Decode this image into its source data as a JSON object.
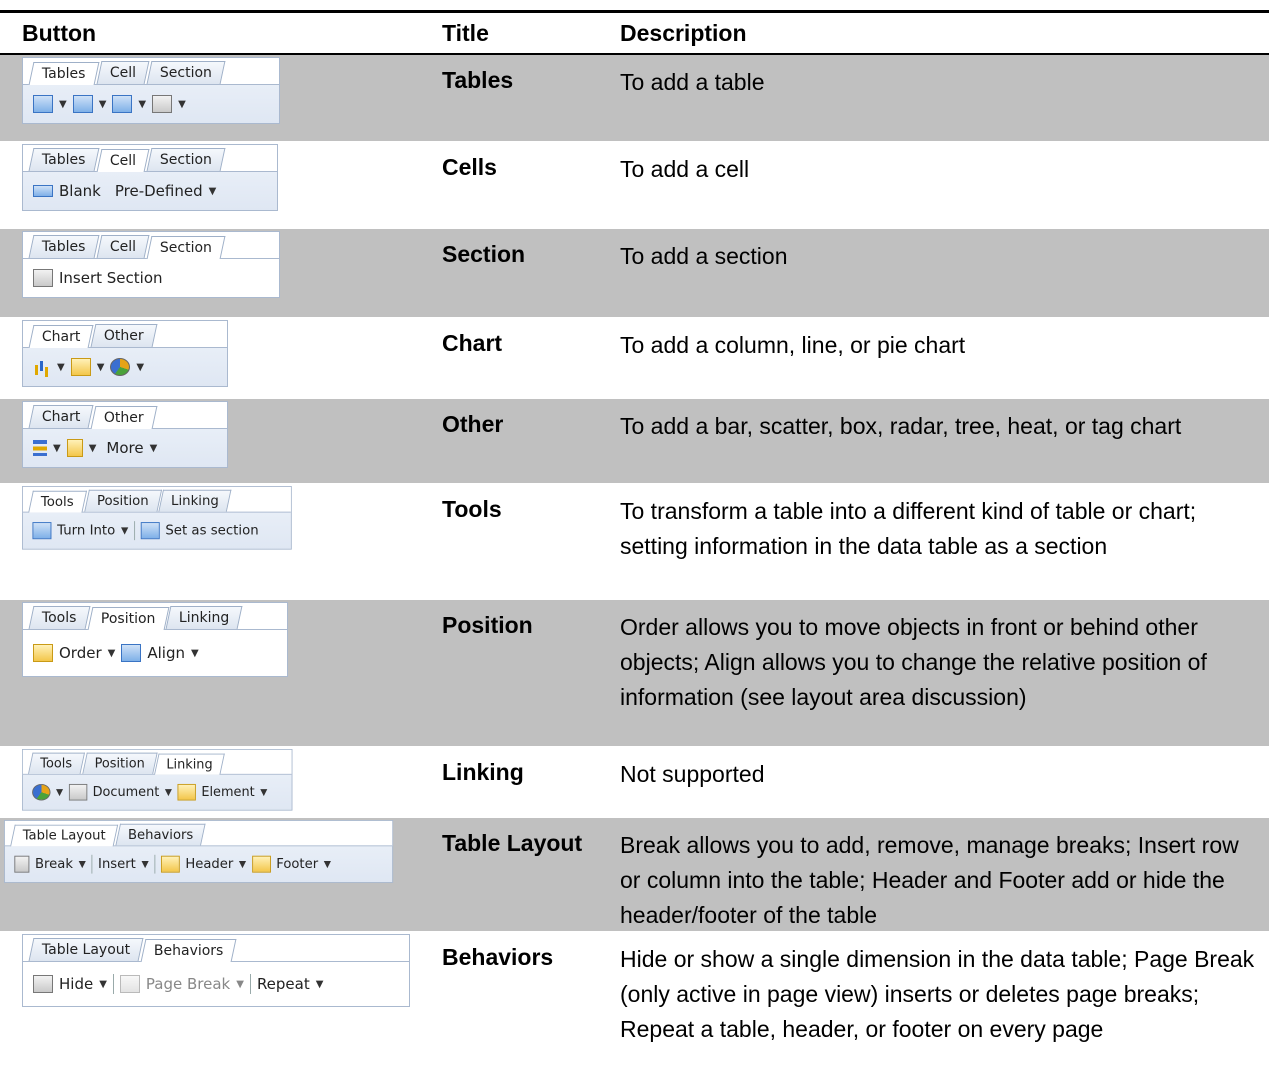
{
  "headers": {
    "button": "Button",
    "title": "Title",
    "description": "Description"
  },
  "rows": [
    {
      "title": "Tables",
      "description": "To add a table",
      "shaded": true,
      "ribbon": {
        "tabs": [
          "Tables",
          "Cell",
          "Section"
        ],
        "active": 0
      }
    },
    {
      "title": "Cells",
      "description": "To add a cell",
      "shaded": false,
      "ribbon": {
        "tabs": [
          "Tables",
          "Cell",
          "Section"
        ],
        "active": 1,
        "items": [
          "Blank",
          "Pre-Defined"
        ]
      }
    },
    {
      "title": "Section",
      "description": "To add a section",
      "shaded": true,
      "ribbon": {
        "tabs": [
          "Tables",
          "Cell",
          "Section"
        ],
        "active": 2,
        "items": [
          "Insert Section"
        ]
      }
    },
    {
      "title": "Chart",
      "description": "To add a column, line, or pie chart",
      "shaded": false,
      "ribbon": {
        "tabs": [
          "Chart",
          "Other"
        ],
        "active": 0
      }
    },
    {
      "title": "Other",
      "description": "To add a bar, scatter, box, radar, tree, heat, or tag chart",
      "shaded": true,
      "ribbon": {
        "tabs": [
          "Chart",
          "Other"
        ],
        "active": 1,
        "items": [
          "More"
        ]
      }
    },
    {
      "title": "Tools",
      "description": "To transform a table into a different kind of table or chart; setting information in the data table as a section",
      "shaded": false,
      "ribbon": {
        "tabs": [
          "Tools",
          "Position",
          "Linking"
        ],
        "active": 0,
        "items": [
          "Turn Into",
          "Set as section"
        ]
      }
    },
    {
      "title": "Position",
      "description": "Order allows you to move objects in front or behind other objects; Align allows you to change the relative position of information (see layout area discussion)",
      "shaded": true,
      "ribbon": {
        "tabs": [
          "Tools",
          "Position",
          "Linking"
        ],
        "active": 1,
        "items": [
          "Order",
          "Align"
        ]
      }
    },
    {
      "title": "Linking",
      "description": "Not supported",
      "shaded": false,
      "ribbon": {
        "tabs": [
          "Tools",
          "Position",
          "Linking"
        ],
        "active": 2,
        "items": [
          "Document",
          "Element"
        ]
      }
    },
    {
      "title": "Table Layout",
      "description": "Break allows you to add, remove, manage breaks; Insert row or column into the table; Header and Footer add or hide the header/footer of the table",
      "shaded": true,
      "ribbon": {
        "tabs": [
          "Table Layout",
          "Behaviors"
        ],
        "active": 0,
        "items": [
          "Break",
          "Insert",
          "Header",
          "Footer"
        ]
      }
    },
    {
      "title": "Behaviors",
      "description": "Hide or show a single dimension in the data table; Page Break (only active in page view) inserts or deletes page breaks; Repeat a table, header, or footer on every page",
      "shaded": false,
      "ribbon": {
        "tabs": [
          "Table Layout",
          "Behaviors"
        ],
        "active": 1,
        "items": [
          "Hide",
          "Page Break",
          "Repeat"
        ]
      }
    }
  ]
}
